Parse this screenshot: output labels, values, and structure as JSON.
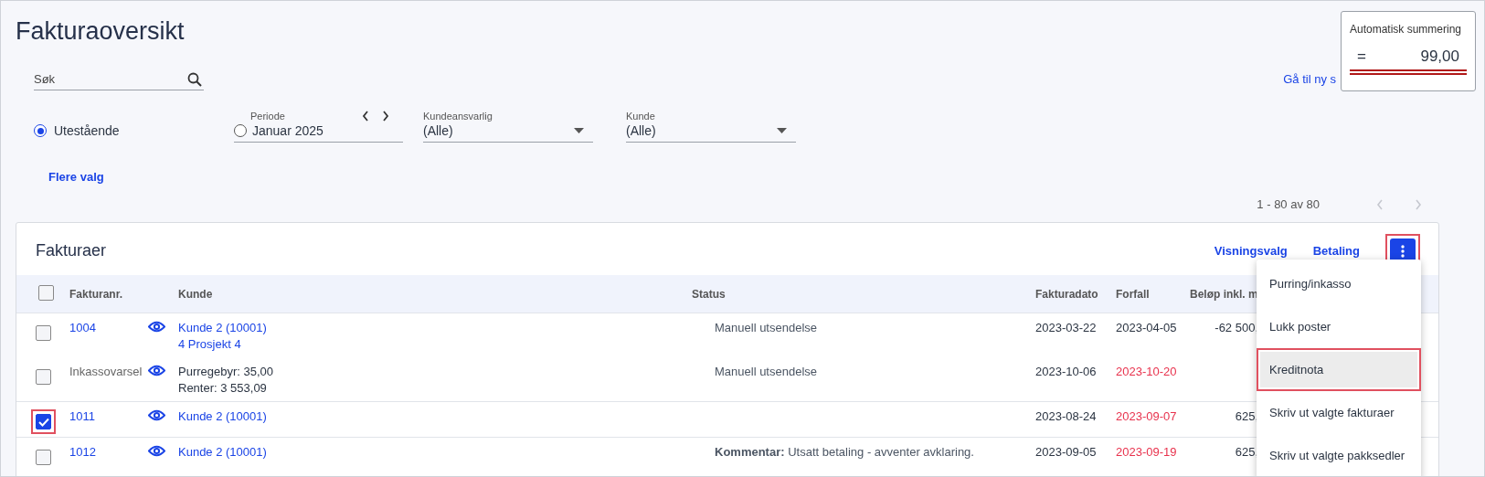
{
  "page_title": "Fakturaoversikt",
  "search": {
    "placeholder": "Søk"
  },
  "filters": {
    "outstanding": {
      "label": "Utestående",
      "selected": true
    },
    "period": {
      "label": "Periode",
      "value": "Januar 2025",
      "selected": false
    },
    "account_manager": {
      "label": "Kundeansvarlig",
      "value": "(Alle)"
    },
    "customer": {
      "label": "Kunde",
      "value": "(Alle)"
    },
    "more_link": "Flere valg"
  },
  "new_link": "Gå til ny s",
  "summary": {
    "title": "Automatisk summering",
    "operator": "=",
    "value": "99,00"
  },
  "pagination": {
    "range": "1 - 80 av 80"
  },
  "invoices": {
    "title": "Fakturaer",
    "actions": [
      "Visningsvalg",
      "Betaling"
    ],
    "menu_button": {
      "highlighted": true
    },
    "select_all": {
      "checked": false
    },
    "columns": [
      "Fakturanr.",
      "Kunde",
      "Status",
      "Fakturadato",
      "Forfall",
      "Beløp inkl. m"
    ],
    "rows": [
      {
        "kind": "invoice",
        "number": "1004",
        "customer": [
          "Kunde 2 (10001)",
          "4 Prosjekt 4"
        ],
        "status": "Manuell utsendelse",
        "invoice_date": "2023-03-22",
        "due_date": "2023-04-05",
        "overdue": false,
        "amount": "-62 500,",
        "checked": false,
        "highlighted": false
      },
      {
        "kind": "notice",
        "number": "Inkassovarsel",
        "customer": [
          "Purregebyr: 35,00",
          "Renter: 3 553,09"
        ],
        "status": "Manuell utsendelse",
        "invoice_date": "2023-10-06",
        "due_date": "2023-10-20",
        "overdue": true,
        "checked": false,
        "highlighted": false
      },
      {
        "kind": "invoice",
        "number": "1011",
        "customer": [
          "Kunde 2 (10001)"
        ],
        "invoice_date": "2023-08-24",
        "due_date": "2023-09-07",
        "overdue": true,
        "amount": "625,",
        "checked": true,
        "highlighted": true
      },
      {
        "kind": "invoice",
        "number": "1012",
        "customer": [
          "Kunde 2 (10001)"
        ],
        "status": "**Kommentar:** Utsatt betaling - avventer avklaring.",
        "invoice_date": "2023-09-05",
        "due_date": "2023-09-19",
        "overdue": true,
        "amount": "625,",
        "checked": false,
        "highlighted": false
      }
    ]
  },
  "menu": {
    "items": [
      {
        "label": "Purring/inkasso",
        "selected": false,
        "highlighted": false
      },
      {
        "label": "Lukk poster",
        "selected": false,
        "highlighted": false
      },
      {
        "label": "Kreditnota",
        "selected": true,
        "highlighted": true
      },
      {
        "label": "Skriv ut valgte fakturaer",
        "selected": false,
        "highlighted": false
      },
      {
        "label": "Skriv ut valgte pakksedler",
        "selected": false,
        "highlighted": false
      }
    ]
  }
}
